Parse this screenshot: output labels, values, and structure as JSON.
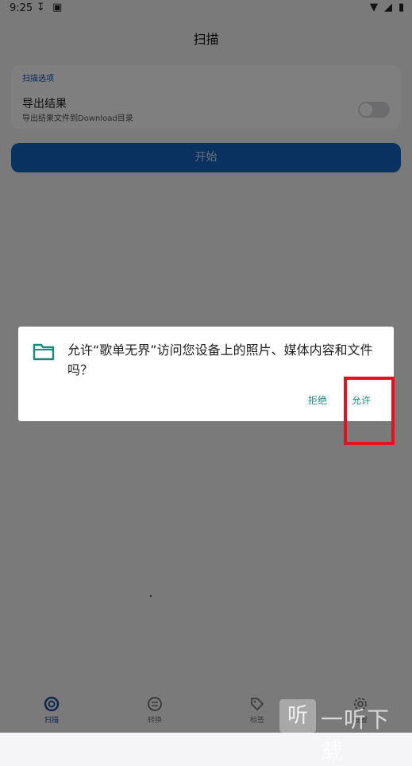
{
  "status_bar": {
    "time": "9:25"
  },
  "app_bar": {
    "title": "扫描"
  },
  "scan_options": {
    "section_title": "扫描选项",
    "export": {
      "title": "导出结果",
      "subtitle": "导出结果文件到Download目录",
      "enabled": false
    }
  },
  "start_button": {
    "label": "开始"
  },
  "bottom_nav": {
    "items": [
      {
        "label": "扫描",
        "active": true
      },
      {
        "label": "转换",
        "active": false
      },
      {
        "label": "标签",
        "active": false
      },
      {
        "label": "设置",
        "active": false
      }
    ]
  },
  "dialog": {
    "message": "允许“歌单无界”访问您设备上的照片、媒体内容和文件吗？",
    "deny_label": "拒绝",
    "allow_label": "允许"
  },
  "watermark": {
    "glyph": "听",
    "text": "一听下载"
  },
  "colors": {
    "accent": "#1565c0",
    "dialog_button": "#1a8a80",
    "highlight": "#e0141e"
  }
}
